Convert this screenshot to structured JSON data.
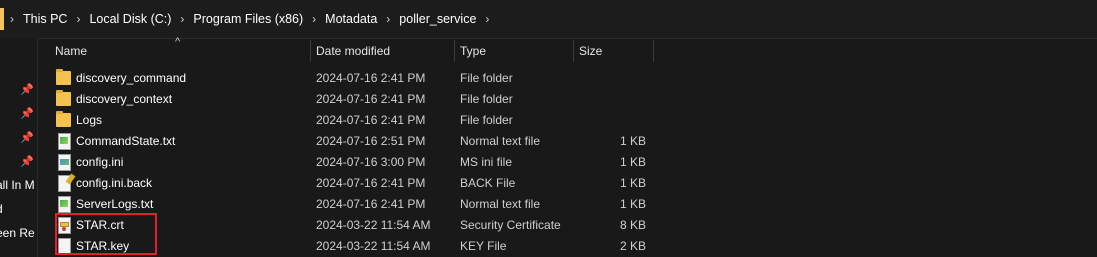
{
  "breadcrumb": [
    {
      "label": "This PC"
    },
    {
      "label": "Local Disk (C:)"
    },
    {
      "label": "Program Files (x86)"
    },
    {
      "label": "Motadata"
    },
    {
      "label": "poller_service"
    }
  ],
  "nav_pane": {
    "labels": [
      "all In M",
      "d",
      "een Re"
    ]
  },
  "columns": {
    "name": "Name",
    "date": "Date modified",
    "type": "Type",
    "size": "Size"
  },
  "files": [
    {
      "name": "discovery_command",
      "date": "2024-07-16 2:41 PM",
      "type": "File folder",
      "size": "",
      "icon": "folder-icon"
    },
    {
      "name": "discovery_context",
      "date": "2024-07-16 2:41 PM",
      "type": "File folder",
      "size": "",
      "icon": "folder-icon"
    },
    {
      "name": "Logs",
      "date": "2024-07-16 2:41 PM",
      "type": "File folder",
      "size": "",
      "icon": "folder-icon"
    },
    {
      "name": "CommandState.txt",
      "date": "2024-07-16 2:51 PM",
      "type": "Normal text file",
      "size": "1 KB",
      "icon": "text-file-icon"
    },
    {
      "name": "config.ini",
      "date": "2024-07-16 3:00 PM",
      "type": "MS ini file",
      "size": "1 KB",
      "icon": "ini-file-icon"
    },
    {
      "name": "config.ini.back",
      "date": "2024-07-16 2:41 PM",
      "type": "BACK File",
      "size": "1 KB",
      "icon": "back-file-icon"
    },
    {
      "name": "ServerLogs.txt",
      "date": "2024-07-16 2:41 PM",
      "type": "Normal text file",
      "size": "1 KB",
      "icon": "text-file-icon"
    },
    {
      "name": "STAR.crt",
      "date": "2024-03-22 11:54 AM",
      "type": "Security Certificate",
      "size": "8 KB",
      "icon": "certificate-file-icon"
    },
    {
      "name": "STAR.key",
      "date": "2024-03-22 11:54 AM",
      "type": "KEY File",
      "size": "2 KB",
      "icon": "blank-file-icon"
    }
  ],
  "colors": {
    "background": "#191919",
    "folder": "#f3c34e",
    "highlight": "#e3202a"
  }
}
